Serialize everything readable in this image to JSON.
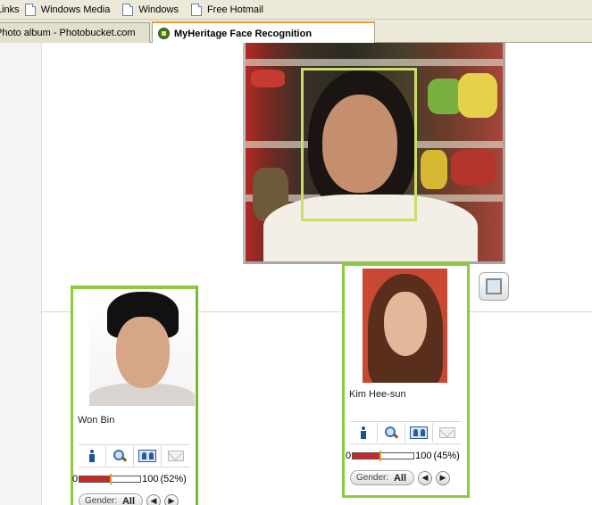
{
  "links_bar": {
    "label": "Links",
    "items": [
      "Windows Media",
      "Windows",
      "Free Hotmail"
    ]
  },
  "tabs": [
    {
      "label": "Photo album - Photobucket.com",
      "active": false
    },
    {
      "label": "MyHeritage Face Recognition",
      "active": true
    }
  ],
  "matches": [
    {
      "name": "Won Bin",
      "rating_min": "0",
      "rating_max": "100",
      "percent_label": "(52%)",
      "percent": 52,
      "gender_label": "Gender:",
      "gender_value": "All"
    },
    {
      "name": "Kim Hee-sun",
      "rating_min": "0",
      "rating_max": "100",
      "percent_label": "(45%)",
      "percent": 45,
      "gender_label": "Gender:",
      "gender_value": "All"
    }
  ],
  "nav": {
    "prev": "◀",
    "next": "▶"
  },
  "colors": {
    "card_border": "#8ccc3c",
    "face_box": "#c6e06a",
    "active_tab_accent": "#f0a030"
  }
}
